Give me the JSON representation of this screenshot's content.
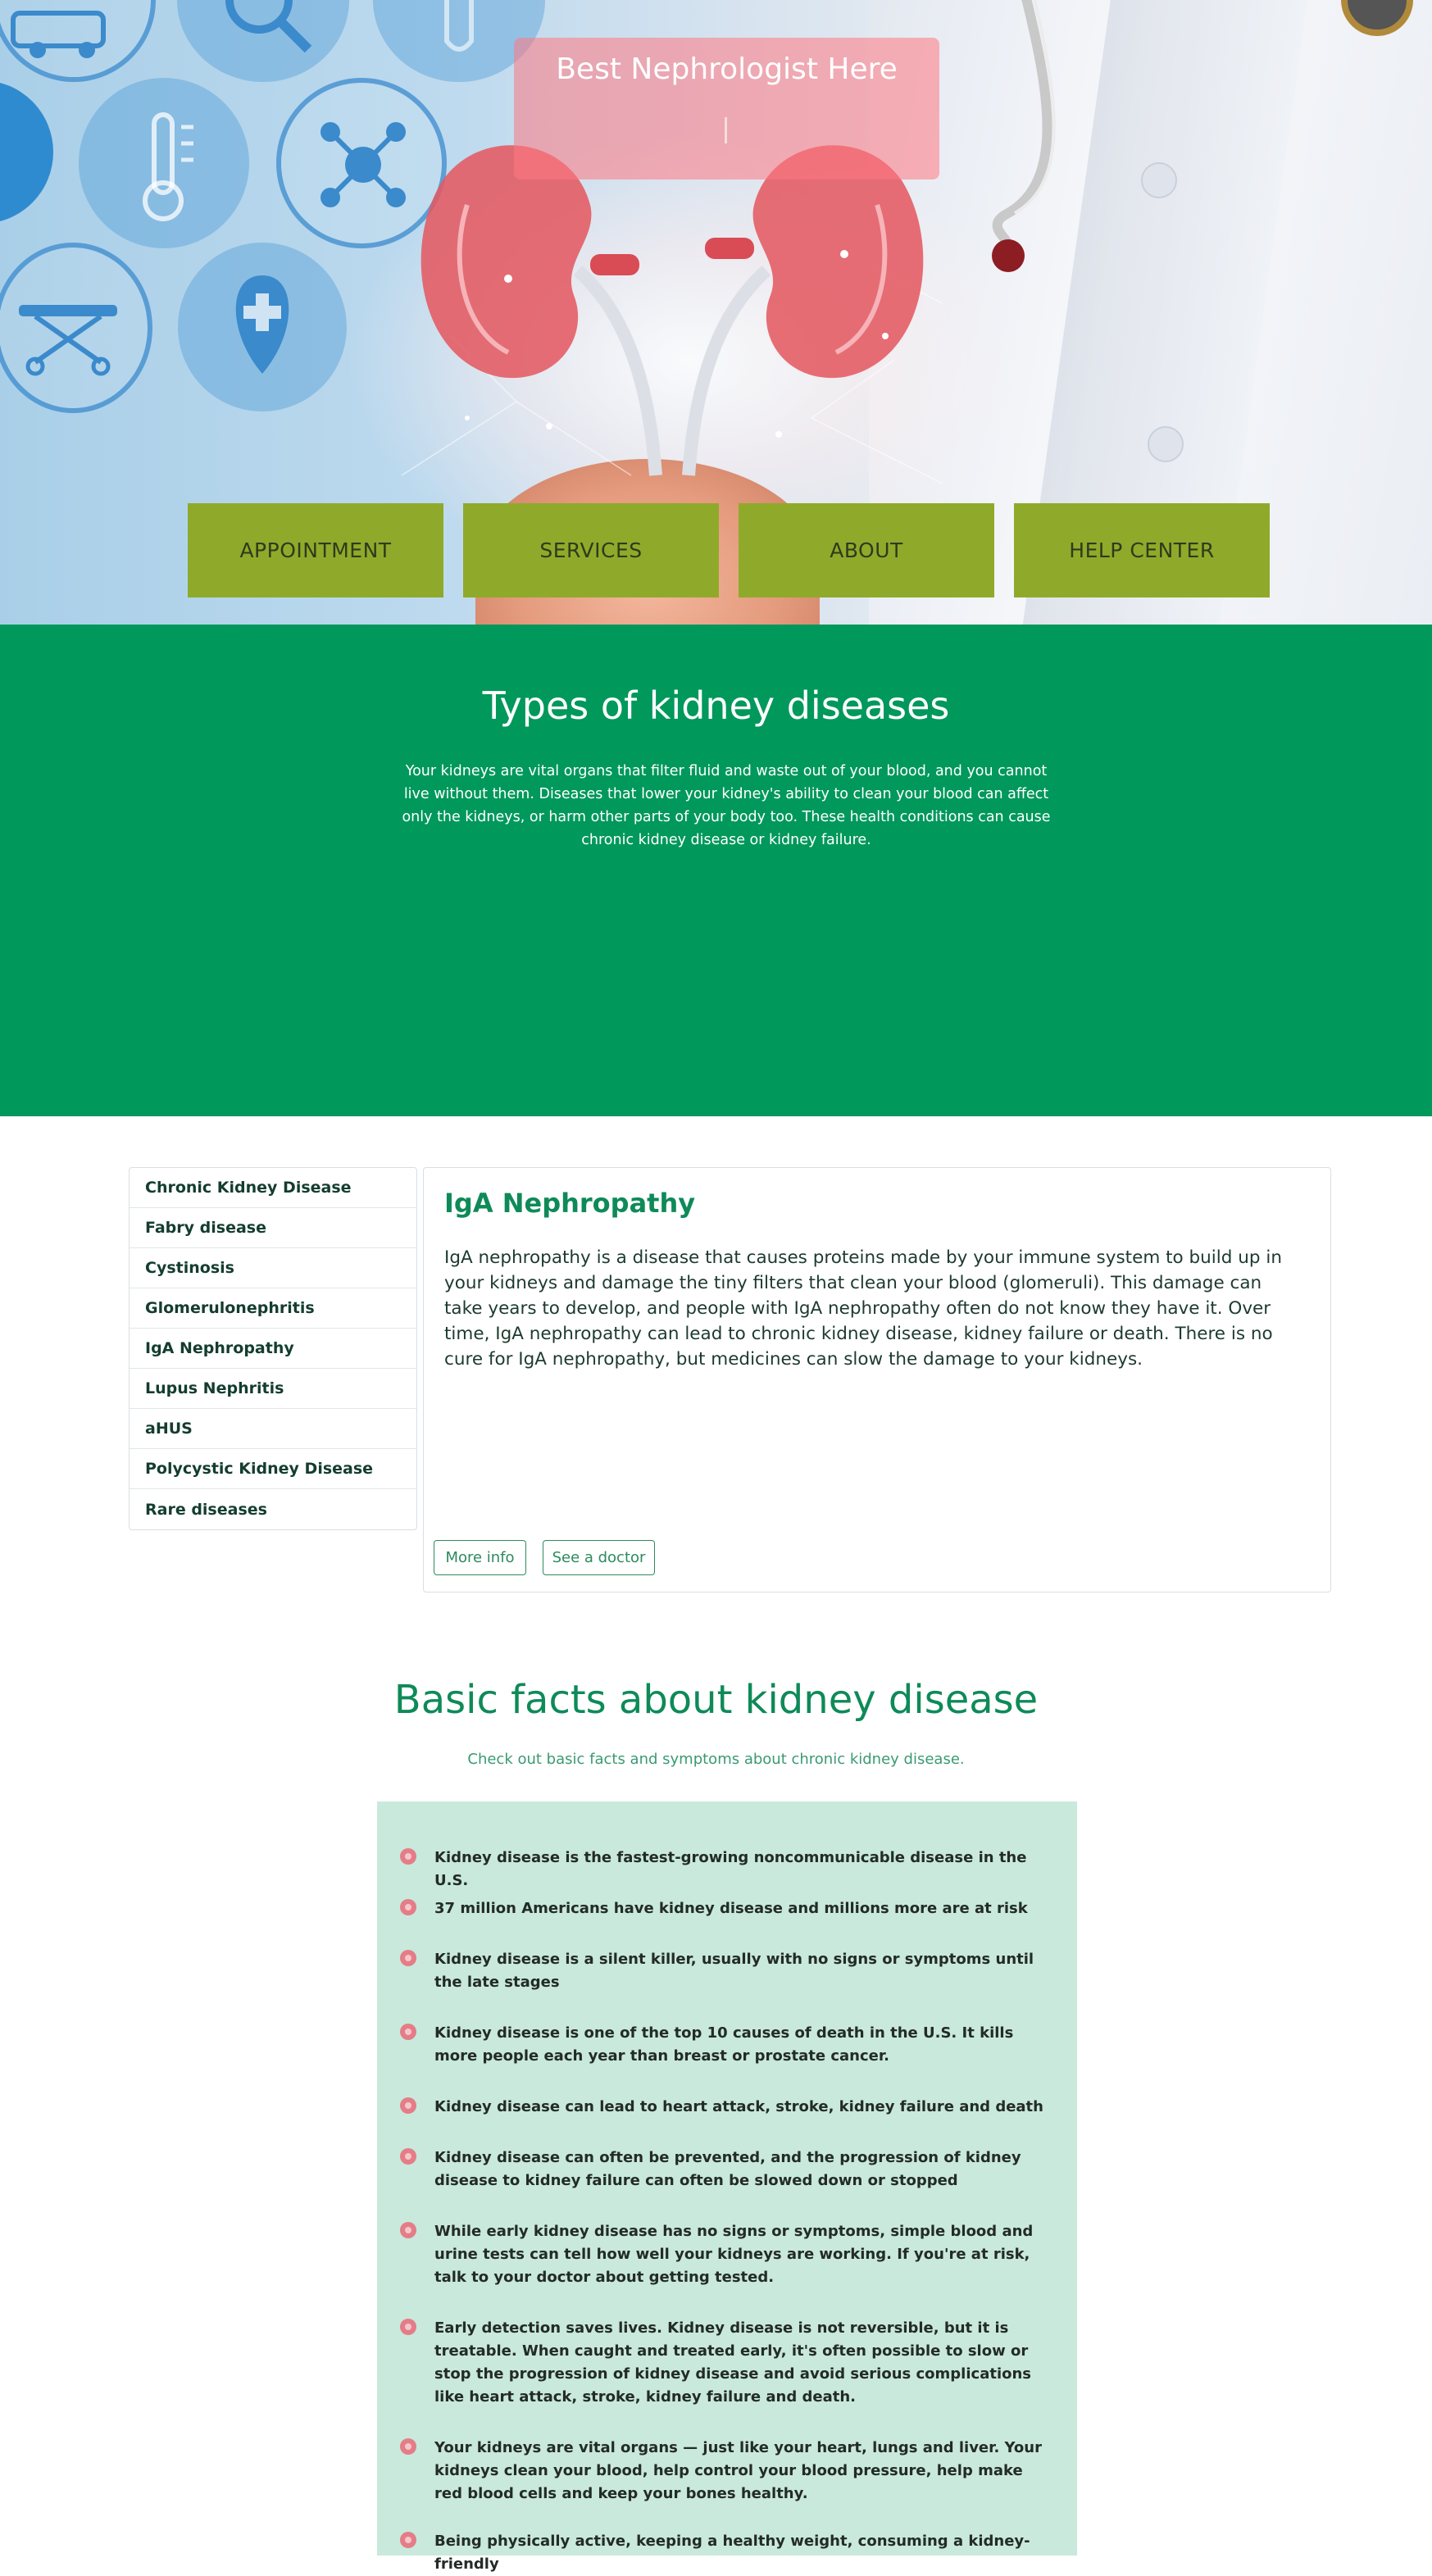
{
  "hero": {
    "title": "Best Nephrologist Here",
    "nav": [
      "APPOINTMENT",
      "SERVICES",
      "ABOUT",
      "HELP CENTER"
    ]
  },
  "intro": {
    "title": "Types of kidney diseases",
    "text": "Your kidneys are vital organs that filter fluid and waste out of your blood, and you cannot live without them. Diseases that lower your kidney's ability to clean your blood can affect only the kidneys, or harm other parts of your body too. These health conditions can cause chronic kidney disease or kidney failure."
  },
  "diseases": {
    "tabs": [
      "Chronic Kidney Disease",
      "Fabry disease",
      "Cystinosis",
      "Glomerulonephritis",
      "IgA Nephropathy",
      "Lupus Nephritis",
      "aHUS",
      "Polycystic Kidney Disease",
      "Rare diseases"
    ],
    "active_title": "IgA Nephropathy",
    "active_text": "IgA nephropathy is a disease that causes proteins made by your immune system to build up in your kidneys and damage the tiny filters that clean your blood (glomeruli). This damage can take years to develop, and people with IgA nephropathy often do not know they have it. Over time, IgA nephropathy can lead to chronic kidney disease, kidney failure or death. There is no cure for IgA nephropathy, but medicines can slow the damage to your kidneys.",
    "more_info": "More info",
    "see_doctor": "See a doctor"
  },
  "facts": {
    "title": "Basic facts about kidney disease",
    "subtitle": "Check out basic facts and symptoms about chronic kidney disease.",
    "items": [
      "Kidney disease is the fastest-growing noncommunicable disease in the U.S.",
      "37 million Americans have kidney disease and millions more are at risk",
      "Kidney disease is a silent killer, usually with no signs or symptoms until the late stages",
      "Kidney disease is one of the top 10 causes of death in the U.S. It kills more people each year than breast or prostate cancer.",
      "Kidney disease can lead to heart attack, stroke, kidney failure and death",
      "Kidney disease can often be prevented, and the progression of kidney disease to kidney failure can often be slowed down or stopped",
      "While early kidney disease has no signs or symptoms, simple blood and urine tests can tell how well your kidneys are working. If you're at risk, talk to your doctor about getting tested.",
      "Early detection saves lives. Kidney disease is not reversible, but it is treatable. When caught and treated early, it's often possible to slow or stop the progression of kidney disease and avoid serious complications like heart attack, stroke, kidney failure and death.",
      "Your kidneys are vital organs — just like your heart, lungs and liver. Your kidneys clean your blood, help control your blood pressure, help make red blood cells and keep your bones healthy.",
      "Being physically active, keeping a healthy weight, consuming a kidney-friendly"
    ]
  }
}
